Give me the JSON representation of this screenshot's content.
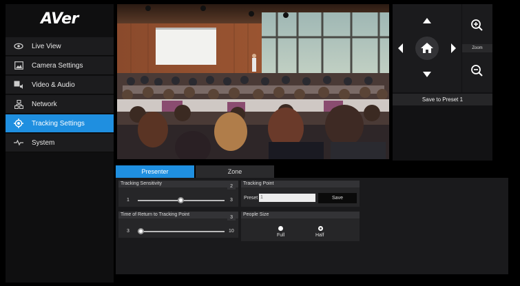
{
  "brand": {
    "logo_text": "AVer"
  },
  "sidebar": {
    "items": [
      {
        "label": "Live View",
        "icon": "eye-icon",
        "active": false
      },
      {
        "label": "Camera Settings",
        "icon": "image-icon",
        "active": false
      },
      {
        "label": "Video & Audio",
        "icon": "video-audio-icon",
        "active": false
      },
      {
        "label": "Network",
        "icon": "network-icon",
        "active": false
      },
      {
        "label": "Tracking Settings",
        "icon": "tracking-target-icon",
        "active": true
      },
      {
        "label": "System",
        "icon": "pulse-icon",
        "active": false
      }
    ]
  },
  "ptz": {
    "zoom_label": "Zoom",
    "save_preset_label": "Save to Preset 1"
  },
  "tabs": [
    {
      "label": "Presenter",
      "active": true
    },
    {
      "label": "Zone",
      "active": false
    }
  ],
  "tracking_sensitivity": {
    "title": "Tracking Sensitivity",
    "value": "2",
    "min": "1",
    "max": "3"
  },
  "return_time": {
    "title": "Time of Return to Tracking Point",
    "value": "3",
    "min": "3",
    "max": "10"
  },
  "tracking_point": {
    "title": "Tracking Point",
    "preset_label": "Preset",
    "preset_value": "1",
    "save_label": "Save"
  },
  "people_size": {
    "title": "People Size",
    "options": [
      {
        "label": "Full",
        "selected": false
      },
      {
        "label": "Half",
        "selected": true
      }
    ]
  },
  "colors": {
    "accent": "#1f8fe0",
    "panel": "#1a1a1c"
  }
}
